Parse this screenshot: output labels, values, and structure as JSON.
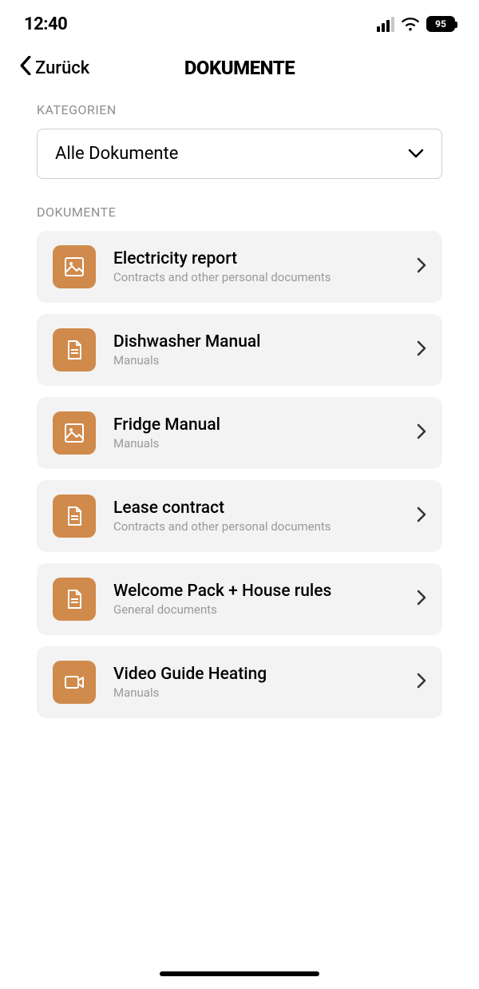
{
  "status": {
    "time": "12:40",
    "battery": "95"
  },
  "nav": {
    "back": "Zurück",
    "title": "DOKUMENTE"
  },
  "sections": {
    "categories_label": "KATEGORIEN",
    "documents_label": "DOKUMENTE"
  },
  "dropdown": {
    "selected": "Alle Dokumente"
  },
  "documents": [
    {
      "icon": "image",
      "title": "Electricity report",
      "subtitle": "Contracts and other personal documents"
    },
    {
      "icon": "file",
      "title": "Dishwasher Manual",
      "subtitle": "Manuals"
    },
    {
      "icon": "image",
      "title": "Fridge Manual",
      "subtitle": "Manuals"
    },
    {
      "icon": "file",
      "title": "Lease contract",
      "subtitle": "Contracts and other personal documents"
    },
    {
      "icon": "file",
      "title": "Welcome Pack + House rules",
      "subtitle": "General documents"
    },
    {
      "icon": "video",
      "title": "Video Guide Heating",
      "subtitle": "Manuals"
    }
  ],
  "colors": {
    "accent": "#d08a4b",
    "item_bg": "#f3f3f3",
    "muted_text": "#9a9a9a"
  }
}
